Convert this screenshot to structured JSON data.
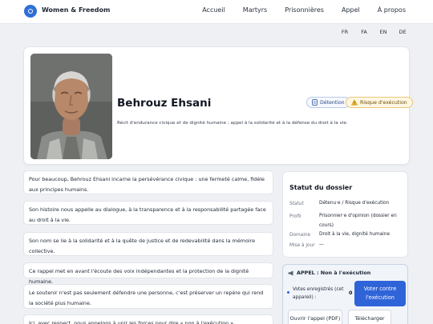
{
  "header": {
    "brand": "Women & Freedom",
    "nav": [
      "Accueil",
      "Martyrs",
      "Prisonnières",
      "Appel",
      "À propos"
    ]
  },
  "languages": [
    "FR",
    "FA",
    "EN",
    "DE"
  ],
  "profile": {
    "name": "Behrouz Ehsani",
    "subtitle": "Récit d'endurance civique et de dignité humaine ; appel à la solidarité et à la défense du droit à la vie.",
    "badges": {
      "detention": "Détention",
      "risk": "Risque d'exécution"
    }
  },
  "paragraphs": [
    "Pour beaucoup, Behrouz Ehsani incarne la persévérance civique : une fermeté calme, fidèle aux principes humains.",
    "Son histoire nous appelle au dialogue, à la transparence et à la responsabilité partagée face au droit à la vie.",
    "Son nom se lie à la solidarité et à la quête de justice et de redevabilité dans la mémoire collective.",
    "Ce rappel met en avant l'écoute des voix indépendantes et la protection de la dignité humaine.",
    "Le soutenir n'est pas seulement défendre une personne, c'est préserver un repère qui rend la société plus humaine.",
    "Ici, avec respect, nous appelons à unir les forces pour dire « non à l'exécution »."
  ],
  "status": {
    "title": "Statut du dossier",
    "rows": [
      {
        "label": "Statut",
        "value": "Détenu·e / Risque d'exécution"
      },
      {
        "label": "Profil",
        "value": "Prisonnier·e d'opinion (dossier en cours)"
      },
      {
        "label": "Domaine",
        "value": "Droit à la vie, dignité humaine"
      },
      {
        "label": "Mise à jour",
        "value": "—"
      }
    ]
  },
  "appeal": {
    "title": "APPEL : Non à l'exécution",
    "votes_label": "Votes enregistrés (cet appareil) :",
    "votes_count": "0",
    "vote_button": "Voter contre l'exécution",
    "open_button": "Ouvrir l'appel (PDF)",
    "download_button": "Télécharger"
  },
  "colors": {
    "accent": "#2f63d8",
    "risk": "#e9c77a"
  }
}
